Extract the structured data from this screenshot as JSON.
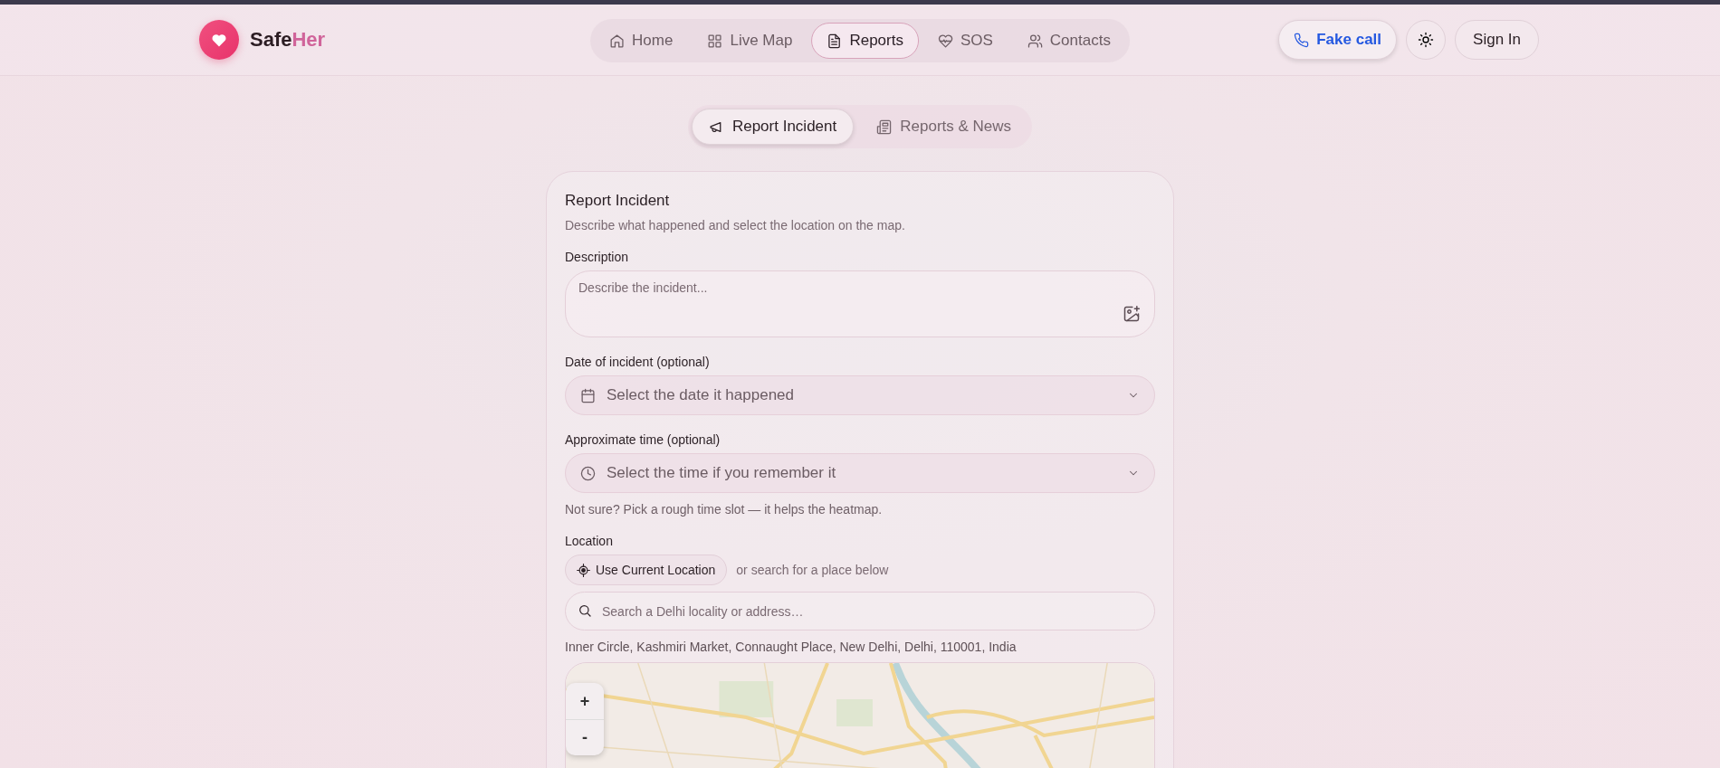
{
  "brand": {
    "name": "Safe",
    "accent": "Her"
  },
  "nav": [
    {
      "label": "Home",
      "selected": false
    },
    {
      "label": "Live Map",
      "selected": false
    },
    {
      "label": "Reports",
      "selected": true
    },
    {
      "label": "SOS",
      "selected": false
    },
    {
      "label": "Contacts",
      "selected": false
    }
  ],
  "actions": {
    "fake_call": "Fake call",
    "sign_in": "Sign In"
  },
  "subtabs": [
    {
      "label": "Report Incident",
      "selected": true
    },
    {
      "label": "Reports & News",
      "selected": false
    }
  ],
  "form": {
    "title": "Report Incident",
    "subtitle": "Describe what happened and select the location on the map.",
    "description": {
      "label": "Description",
      "placeholder": "Describe the incident..."
    },
    "date": {
      "label": "Date of incident (optional)",
      "placeholder": "Select the date it happened"
    },
    "time": {
      "label": "Approximate time (optional)",
      "placeholder": "Select the time if you remember it",
      "hint": "Not sure? Pick a rough time slot — it helps the heatmap."
    },
    "location": {
      "label": "Location",
      "button": "Use Current Location",
      "or_text": "or search for a place below",
      "search_placeholder": "Search a Delhi locality or address…",
      "address": "Inner Circle, Kashmiri Market, Connaught Place, New Delhi, Delhi, 110001, India"
    },
    "map": {
      "zoom_in": "+",
      "zoom_out": "-"
    }
  }
}
